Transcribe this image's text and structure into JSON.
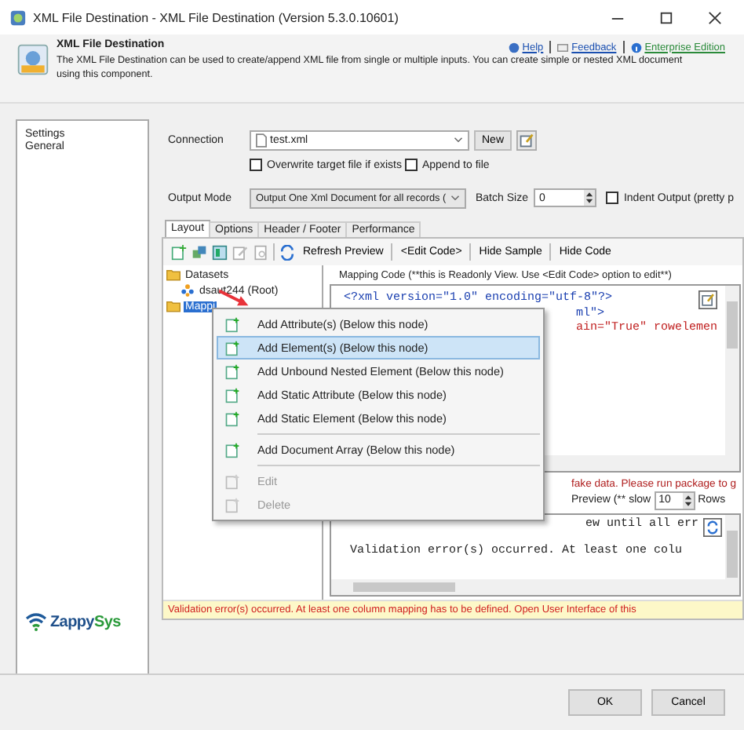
{
  "window": {
    "title": "XML File Destination - XML File Destination (Version 5.3.0.10601)"
  },
  "header": {
    "title": "XML File Destination",
    "description": "The XML File Destination can be used to create/append XML file from single or multiple inputs. You can create simple or nested XML document using this component.",
    "links": [
      "Help",
      "Feedback",
      "Enterprise Edition"
    ]
  },
  "sidebar": {
    "items": [
      {
        "label": "Settings"
      },
      {
        "label": "General"
      }
    ],
    "logo": [
      "Zappy",
      "Sys"
    ]
  },
  "connection": {
    "label": "Connection",
    "value": "test.xml",
    "new_button": "New"
  },
  "options": [
    {
      "label": "Overwrite target file if exists",
      "checked": false
    },
    {
      "label": "Append to file",
      "checked": false
    }
  ],
  "output_mode": {
    "label": "Output Mode",
    "value": "Output One Xml Document for all records (",
    "batch_label": "Batch Size",
    "batch_value": "0",
    "indent": {
      "label": "Indent Output (pretty p",
      "checked": false
    }
  },
  "tabs": [
    {
      "label": "Layout",
      "selected": true
    },
    {
      "label": "Options",
      "selected": false
    },
    {
      "label": "Header / Footer",
      "selected": false
    },
    {
      "label": "Performance",
      "selected": false
    }
  ],
  "toolbar": [
    "Refresh Preview",
    "<Edit Code>",
    "Hide Sample",
    "Hide Code"
  ],
  "tree": [
    {
      "label": "Datasets",
      "selected": false,
      "children": [
        {
          "label": "dsaut244 (Root)",
          "selected": false
        }
      ]
    },
    {
      "label": "Mappi",
      "selected": true
    }
  ],
  "mapping_code": {
    "caption": "Mapping Code (**this is Readonly View. Use <Edit Code> option to edit**)",
    "lines": [
      "<?xml version=\"1.0\" encoding=\"utf-8\"?>",
      "ml\">",
      "ain=\"True\" rowelemen"
    ]
  },
  "preview": {
    "notice": "fake data. Please run package to g",
    "label": "Preview (** slow",
    "rows_value": "10",
    "rows_label": "Rows",
    "output_lines": [
      "ew until all err",
      "Validation error(s) occurred. At least one colu"
    ]
  },
  "error_bar": "Validation error(s) occurred. At least one column mapping has to be defined. Open User Interface of this",
  "context_menu": [
    {
      "kind": "item",
      "label": "Add Attribute(s) (Below this node)",
      "selected": false,
      "disabled": false
    },
    {
      "kind": "item",
      "label": "Add Element(s) (Below this node)",
      "selected": true,
      "disabled": false
    },
    {
      "kind": "item",
      "label": "Add Unbound Nested Element (Below this node)",
      "selected": false,
      "disabled": false
    },
    {
      "kind": "item",
      "label": "Add Static Attribute (Below this node)",
      "selected": false,
      "disabled": false
    },
    {
      "kind": "item",
      "label": "Add Static Element (Below this node)",
      "selected": false,
      "disabled": false
    },
    {
      "kind": "separator"
    },
    {
      "kind": "item",
      "label": "Add Document Array (Below this node)",
      "selected": false,
      "disabled": false
    },
    {
      "kind": "separator"
    },
    {
      "kind": "item",
      "label": "Edit",
      "selected": false,
      "disabled": true
    },
    {
      "kind": "item",
      "label": "Delete",
      "selected": false,
      "disabled": true
    }
  ],
  "buttons": [
    "OK",
    "Cancel"
  ]
}
